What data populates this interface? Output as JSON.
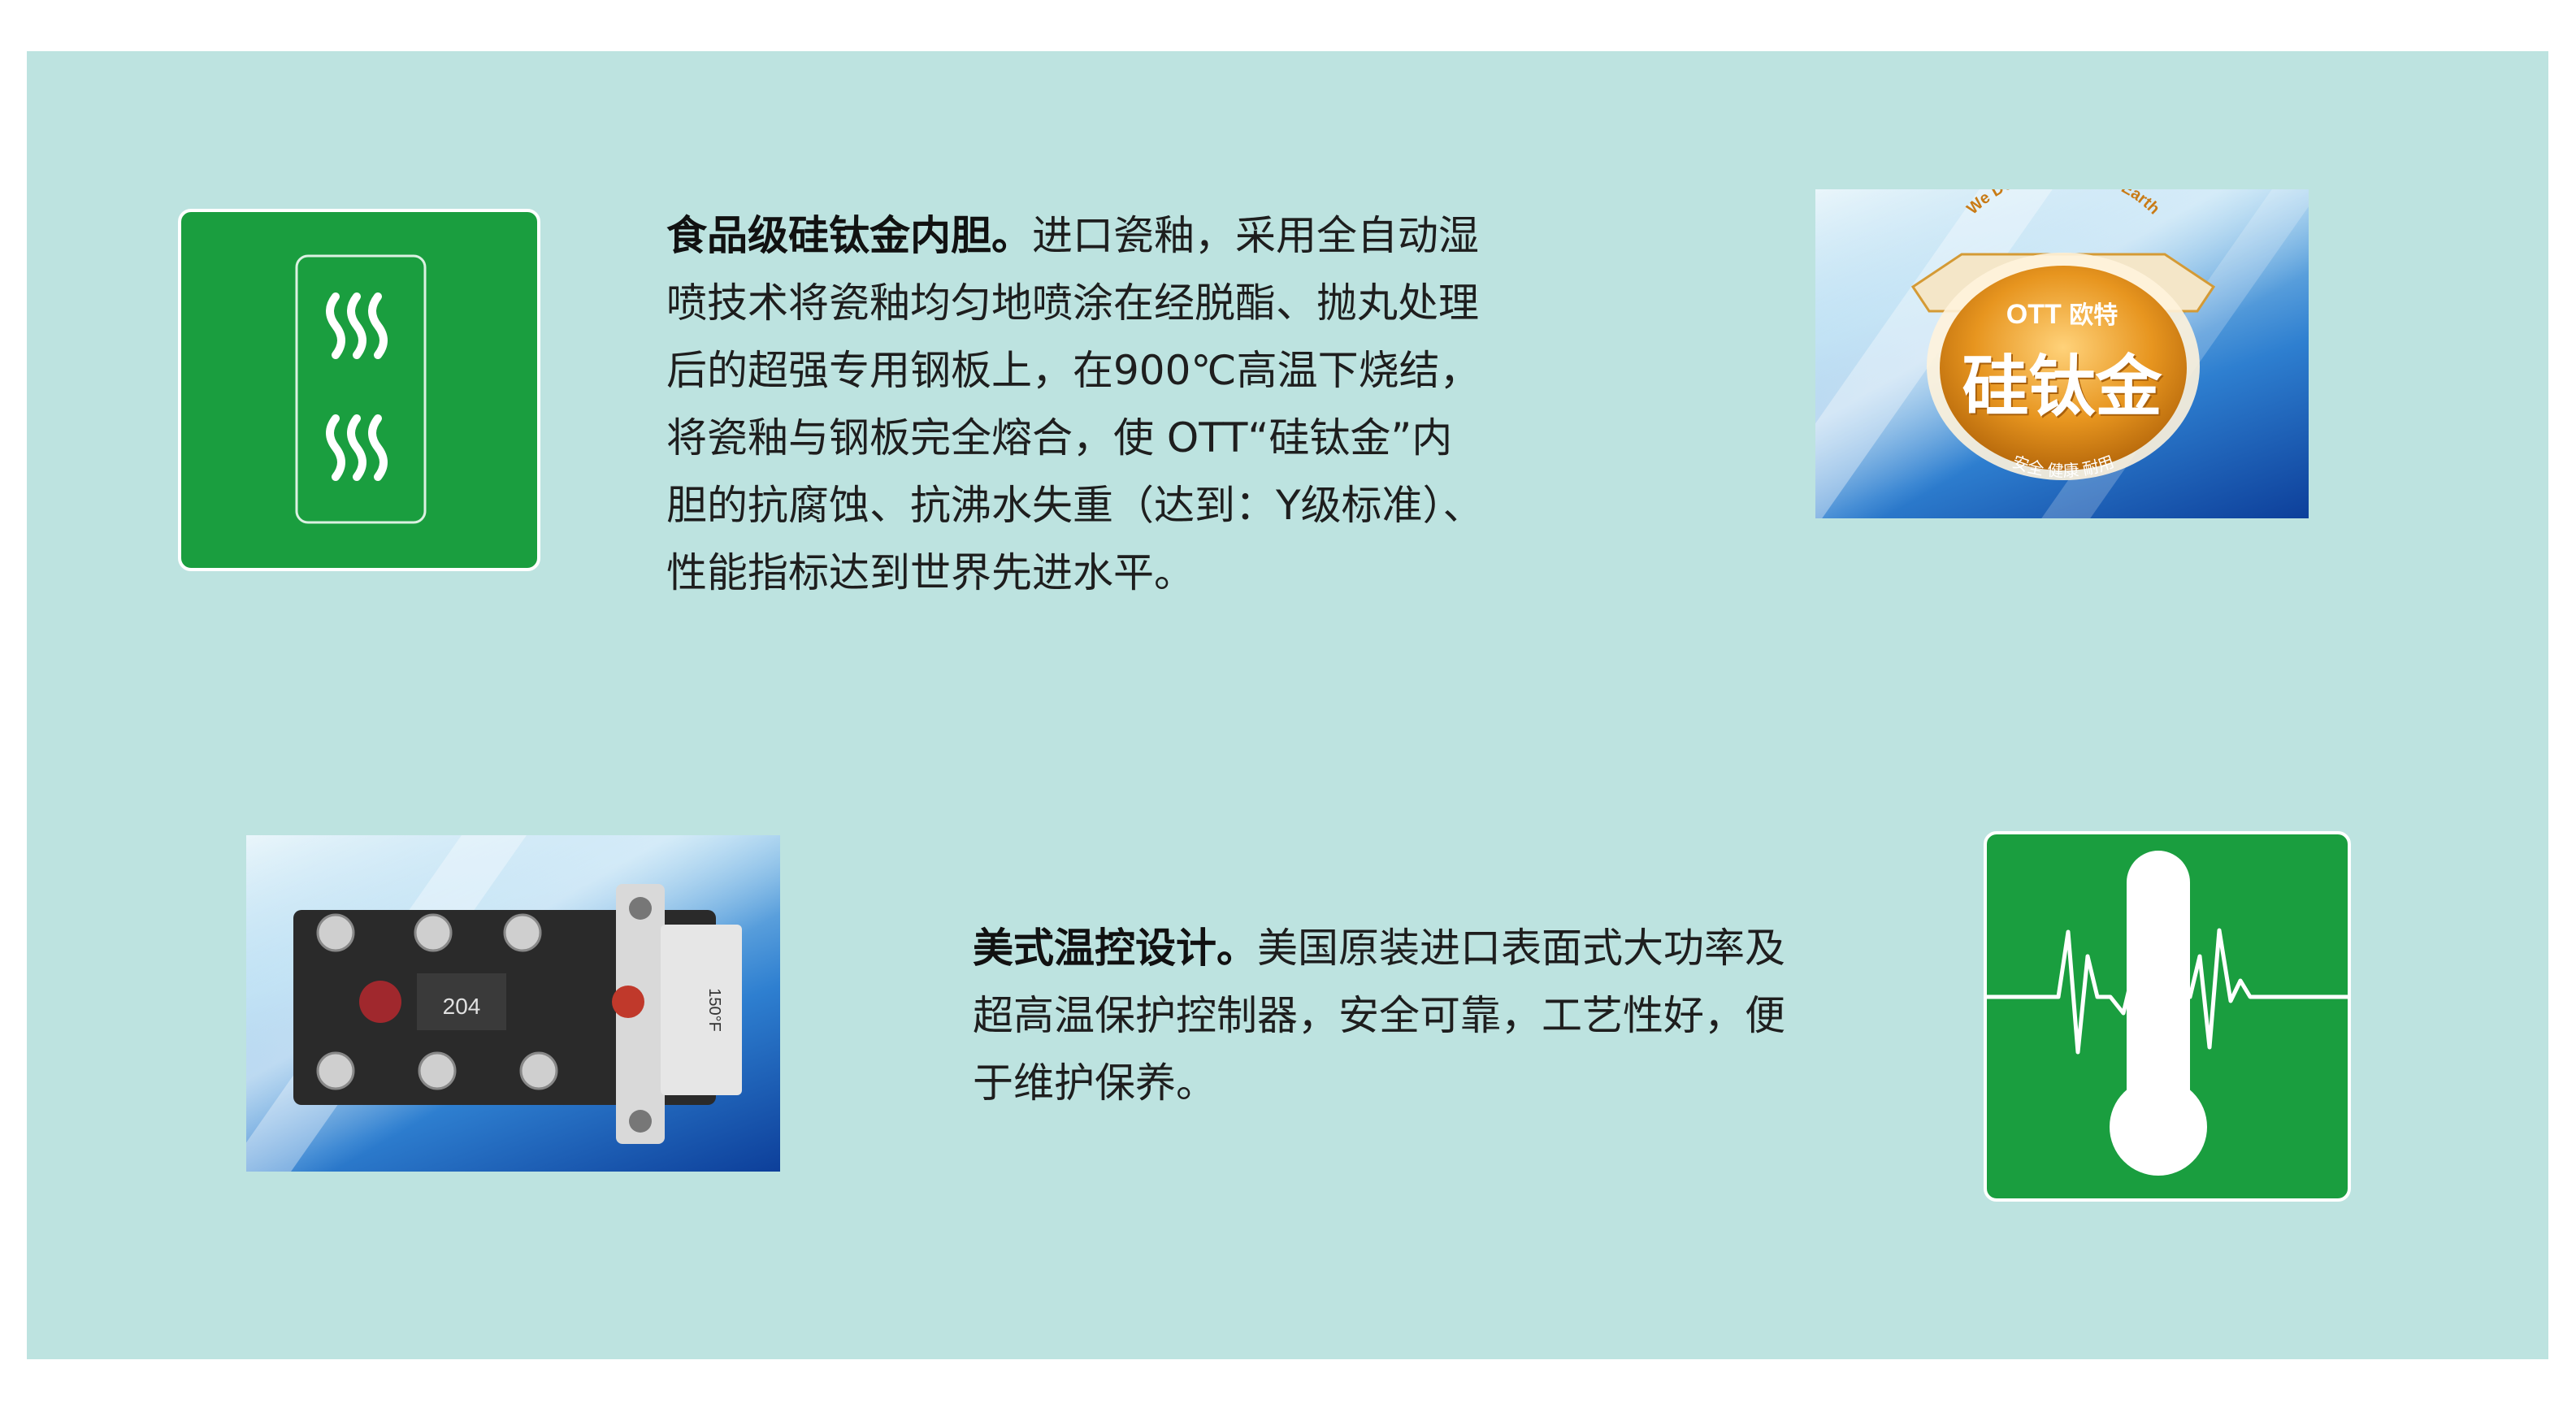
{
  "section1": {
    "heading": "食品级硅钛金内胆。",
    "lines": [
      "进口瓷釉，采用全自动湿",
      "喷技术将瓷釉均匀地喷涂在经脱酯、抛丸处理",
      "后的超强专用钢板上，在900℃高温下烧结，",
      "将瓷釉与钢板完全熔合，使 OTT“硅钛金”内",
      "胆的抗腐蚀、抗沸水失重（达到：Y级标准）、",
      "性能指标达到世界先进水平。"
    ]
  },
  "badge": {
    "arc_text": "We Do Care For Our Earth",
    "brand": "OTT",
    "brand_cn": "欧特",
    "title": "硅钛金",
    "tagline": "安全 健康 耐用"
  },
  "section2": {
    "heading": "美式温控设计。",
    "lines": [
      "美国原装进口表面式大功率及",
      "超高温保护控制器，安全可靠，工艺性好，便",
      "于维护保养。"
    ]
  },
  "thermostat_marks": {
    "left_code": "204",
    "right_rating": "150°F"
  },
  "colors": {
    "panel": "#bde3e0",
    "tile_green": "#1a9e3f",
    "badge_orange": "#e7951f"
  },
  "icons": {
    "steam": "steam-icon",
    "thermometer": "thermometer-heartbeat-icon"
  }
}
